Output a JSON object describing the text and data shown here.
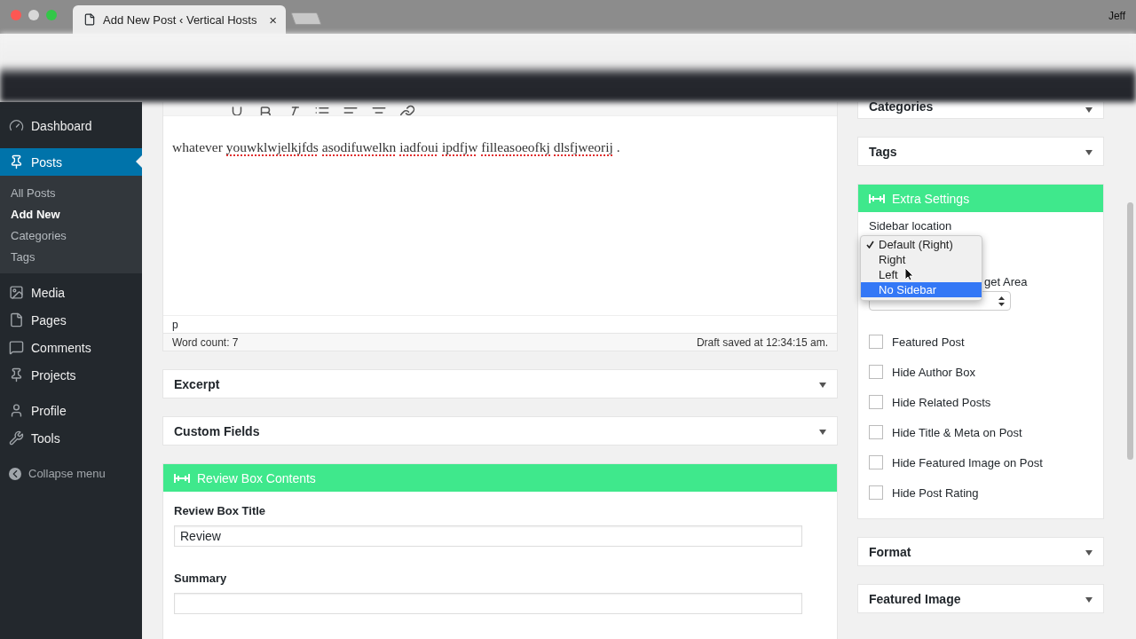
{
  "browser": {
    "tab_title": "Add New Post ‹ Vertical Hosts",
    "tab_close": "×",
    "user": "Jeff"
  },
  "sidebar": {
    "groups": [
      [
        {
          "label": "Dashboard",
          "selected": false
        },
        {
          "label": "Posts",
          "selected": true,
          "children": [
            {
              "label": "All Posts",
              "selected": false
            },
            {
              "label": "Add New",
              "selected": true
            },
            {
              "label": "Categories",
              "selected": false
            },
            {
              "label": "Tags",
              "selected": false
            }
          ]
        },
        {
          "label": "Media",
          "selected": false
        },
        {
          "label": "Pages",
          "selected": false
        },
        {
          "label": "Comments",
          "selected": false
        },
        {
          "label": "Projects",
          "selected": false
        }
      ],
      [
        {
          "label": "Profile",
          "selected": false
        },
        {
          "label": "Tools",
          "selected": false
        }
      ]
    ],
    "collapse": "Collapse menu"
  },
  "editor": {
    "words": [
      {
        "text": "whatever",
        "misspelled": false
      },
      {
        "text": "youwklwjelkjfds",
        "misspelled": true
      },
      {
        "text": "asodifuwelkn",
        "misspelled": true
      },
      {
        "text": "iadfoui",
        "misspelled": true
      },
      {
        "text": "ipdfjw",
        "misspelled": true
      },
      {
        "text": "filleasoeofkj",
        "misspelled": true
      },
      {
        "text": "dlsfjweorij",
        "misspelled": true
      },
      {
        "text": ".",
        "misspelled": false
      }
    ],
    "path": "p",
    "word_count": "Word count: 7",
    "draft_status": "Draft saved at 12:34:15 am."
  },
  "main_boxes": [
    {
      "title": "Excerpt",
      "kind": "collapsed"
    },
    {
      "title": "Custom Fields",
      "kind": "collapsed"
    },
    {
      "title": "Review Box Contents",
      "kind": "highlight",
      "fields": [
        {
          "label": "Review Box Title",
          "value": "Review"
        },
        {
          "label": "Summary"
        }
      ]
    }
  ],
  "side_boxes": [
    {
      "title": "Categories",
      "kind": "cut"
    },
    {
      "title": "Tags",
      "kind": "collapsed"
    },
    {
      "title": "Extra Settings",
      "kind": "settings",
      "sidebar_location": {
        "label": "Sidebar location",
        "options": [
          {
            "label": "Default (Right)",
            "checked": true,
            "selected": false
          },
          {
            "label": "Right",
            "checked": false,
            "selected": false
          },
          {
            "label": "Left",
            "checked": false,
            "selected": false
          },
          {
            "label": "No Sidebar",
            "checked": false,
            "selected": true
          }
        ]
      },
      "widget_area": {
        "label": "get Area"
      },
      "checkboxes": [
        {
          "label": "Featured Post",
          "checked": false
        },
        {
          "label": "Hide Author Box",
          "checked": false
        },
        {
          "label": "Hide Related Posts",
          "checked": false
        },
        {
          "label": "Hide Title & Meta on Post",
          "checked": false
        },
        {
          "label": "Hide Featured Image on Post",
          "checked": false
        },
        {
          "label": "Hide Post Rating",
          "checked": false
        }
      ]
    },
    {
      "title": "Format",
      "kind": "collapsed"
    },
    {
      "title": "Featured Image",
      "kind": "collapsed"
    }
  ]
}
